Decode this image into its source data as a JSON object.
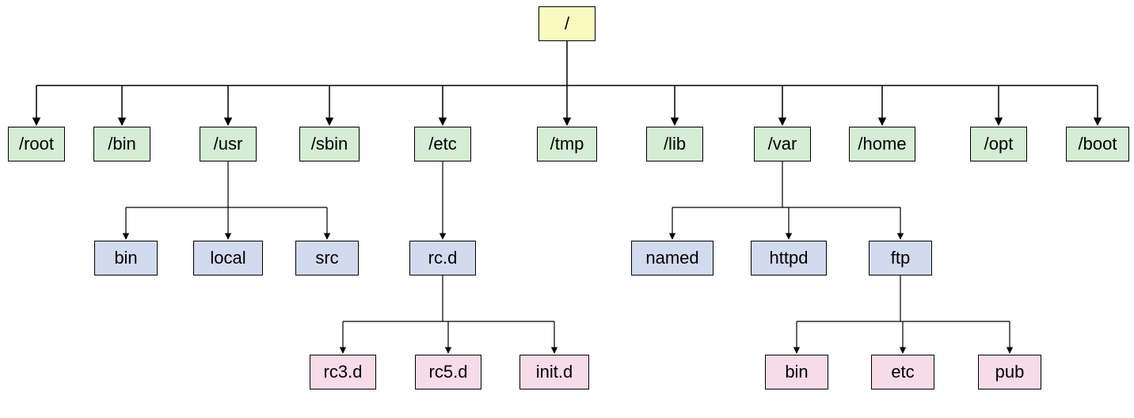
{
  "tree": {
    "root": "/",
    "level1": {
      "root": "/root",
      "bin": "/bin",
      "usr": "/usr",
      "sbin": "/sbin",
      "etc": "/etc",
      "tmp": "/tmp",
      "lib": "/lib",
      "var": "/var",
      "home": "/home",
      "opt": "/opt",
      "boot": "/boot"
    },
    "level2": {
      "usr_bin": "bin",
      "usr_local": "local",
      "usr_src": "src",
      "etc_rcd": "rc.d",
      "var_named": "named",
      "var_httpd": "httpd",
      "var_ftp": "ftp"
    },
    "level3": {
      "rc3d": "rc3.d",
      "rc5d": "rc5.d",
      "initd": "init.d",
      "ftp_bin": "bin",
      "ftp_etc": "etc",
      "ftp_pub": "pub"
    }
  }
}
